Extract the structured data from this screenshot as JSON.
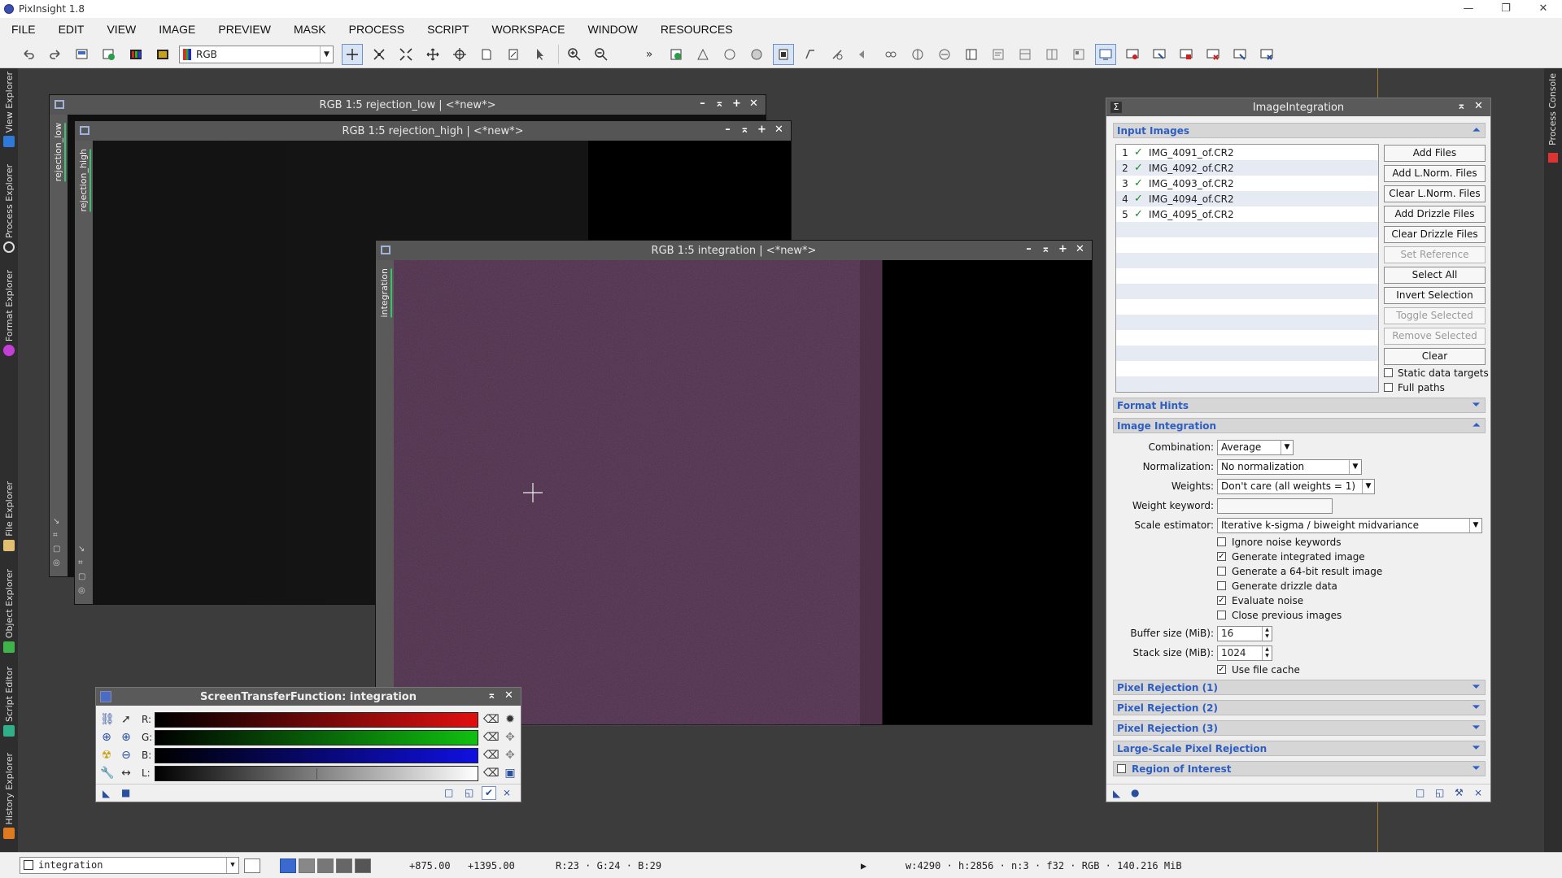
{
  "app": {
    "title": "PixInsight 1.8"
  },
  "window_controls": {
    "minimize": "—",
    "restore": "❐",
    "close": "✕"
  },
  "menu": [
    "FILE",
    "EDIT",
    "VIEW",
    "IMAGE",
    "PREVIEW",
    "MASK",
    "PROCESS",
    "SCRIPT",
    "WORKSPACE",
    "WINDOW",
    "RESOURCES"
  ],
  "toolbar": {
    "channel_combo": "RGB",
    "more": "»"
  },
  "left_dock": [
    "View Explorer",
    "Process Explorer",
    "Format Explorer",
    "File Explorer",
    "Object Explorer",
    "Script Editor",
    "History Explorer"
  ],
  "right_dock": {
    "label": "Process Console"
  },
  "windows": {
    "rejection_low": {
      "title": "RGB 1:5 rejection_low | <*new*>",
      "tab": "rejection_low"
    },
    "rejection_high": {
      "title": "RGB 1:5 rejection_high | <*new*>",
      "tab": "rejection_high"
    },
    "integration": {
      "title": "RGB 1:5 integration | <*new*>",
      "tab": "integration"
    }
  },
  "win_btns": {
    "min": "–",
    "shade": "⌅",
    "max": "+",
    "close": "✕"
  },
  "stf": {
    "title": "ScreenTransferFunction: integration",
    "channels": [
      "R:",
      "G:",
      "B:",
      "L:"
    ],
    "colors": {
      "r": "#e01010",
      "g": "#10c010",
      "b": "#1010e0",
      "l": "#ffffff"
    }
  },
  "ii": {
    "title": "ImageIntegration",
    "sections": {
      "input_images": "Input Images",
      "format_hints": "Format Hints",
      "image_integration": "Image Integration",
      "pixel_rejection_1": "Pixel Rejection (1)",
      "pixel_rejection_2": "Pixel Rejection (2)",
      "pixel_rejection_3": "Pixel Rejection (3)",
      "large_scale": "Large-Scale Pixel Rejection",
      "roi": "Region of Interest"
    },
    "files": [
      {
        "index": "1",
        "name": "IMG_4091_of.CR2"
      },
      {
        "index": "2",
        "name": "IMG_4092_of.CR2"
      },
      {
        "index": "3",
        "name": "IMG_4093_of.CR2"
      },
      {
        "index": "4",
        "name": "IMG_4094_of.CR2"
      },
      {
        "index": "5",
        "name": "IMG_4095_of.CR2"
      }
    ],
    "buttons": [
      {
        "label": "Add Files",
        "enabled": true
      },
      {
        "label": "Add L.Norm. Files",
        "enabled": true
      },
      {
        "label": "Clear L.Norm. Files",
        "enabled": true
      },
      {
        "label": "Add Drizzle Files",
        "enabled": true
      },
      {
        "label": "Clear Drizzle Files",
        "enabled": true
      },
      {
        "label": "Set Reference",
        "enabled": false
      },
      {
        "label": "Select All",
        "enabled": true
      },
      {
        "label": "Invert Selection",
        "enabled": true
      },
      {
        "label": "Toggle Selected",
        "enabled": false
      },
      {
        "label": "Remove Selected",
        "enabled": false
      },
      {
        "label": "Clear",
        "enabled": true
      }
    ],
    "static_targets": "Static data targets",
    "full_paths": "Full paths",
    "combination_label": "Combination:",
    "combination": "Average",
    "normalization_label": "Normalization:",
    "normalization": "No normalization",
    "weights_label": "Weights:",
    "weights": "Don't care (all weights = 1)",
    "weight_keyword_label": "Weight keyword:",
    "weight_keyword": "",
    "scale_estimator_label": "Scale estimator:",
    "scale_estimator": "Iterative k-sigma / biweight midvariance",
    "options": [
      {
        "label": "Ignore noise keywords",
        "checked": false
      },
      {
        "label": "Generate integrated image",
        "checked": true
      },
      {
        "label": "Generate a 64-bit result image",
        "checked": false
      },
      {
        "label": "Generate drizzle data",
        "checked": false
      },
      {
        "label": "Evaluate noise",
        "checked": true
      },
      {
        "label": "Close previous images",
        "checked": false
      }
    ],
    "buffer_label": "Buffer size (MiB):",
    "buffer": "16",
    "stack_label": "Stack size (MiB):",
    "stack": "1024",
    "file_cache": "Use file cache"
  },
  "status": {
    "view": "integration",
    "x": "+875.00",
    "y": "+1395.00",
    "rgb": "R:23 · G:24 · B:29",
    "play": "▶",
    "info": "w:4290 · h:2856 · n:3 · f32 · RGB · 140.216 MiB"
  }
}
